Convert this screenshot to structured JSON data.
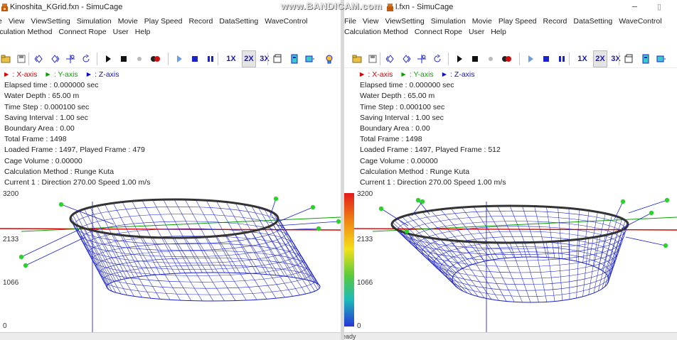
{
  "left": {
    "title": "Kinoshita_KGrid.fxn - SimuCage",
    "menu_row1": [
      "e",
      "View",
      "ViewSetting",
      "Simulation",
      "Movie",
      "Play Speed",
      "Record",
      "DataSetting",
      "WaveControl"
    ],
    "menu_row2": [
      "lculation Method",
      "Connect Rope",
      "User",
      "Help"
    ],
    "toolbar": {
      "speed_1x": "1X",
      "speed_2x": "2X",
      "speed_3x": "3X"
    },
    "axis_legend": {
      "x": ": X-axis",
      "y": ": Y-axis",
      "z": ": Z-axis"
    },
    "info": [
      "Elapsed time : 0.000000 sec",
      "Water Depth : 65.00 m",
      "Time Step : 0.000100 sec",
      "Saving Interval : 1.00 sec",
      "Boundary Area : 0.00",
      "Total Frame : 1498",
      "Loaded Frame : 1497, Played Frame : 479",
      "Cage Volume : 0.00000",
      "Calculation Method : Runge Kuta",
      "Current 1 : Direction 270.00 Speed 1.00 m/s"
    ],
    "depth_ticks": [
      "3200",
      "2133",
      "1066",
      "0"
    ]
  },
  "right": {
    "title": "l.fxn - SimuCage",
    "menu_row1": [
      "File",
      "View",
      "ViewSetting",
      "Simulation",
      "Movie",
      "Play Speed",
      "Record",
      "DataSetting",
      "WaveControl"
    ],
    "menu_row2": [
      "Calculation Method",
      "Connect Rope",
      "User",
      "Help"
    ],
    "toolbar": {
      "speed_1x": "1X",
      "speed_2x": "2X",
      "speed_3x": "3X"
    },
    "axis_legend": {
      "x": ": X-axis",
      "y": ": Y-axis",
      "z": ": Z-axis"
    },
    "info": [
      "Elapsed time : 0.000000 sec",
      "Water Depth : 65.00 m",
      "Time Step : 0.000100 sec",
      "Saving Interval : 1.00 sec",
      "Boundary Area : 0.00",
      "Total Frame : 1498",
      "Loaded Frame : 1497, Played Frame : 512",
      "Cage Volume : 0.00000",
      "Calculation Method : Runge Kuta",
      "Current 1 : Direction 270.00 Speed 1.00 m/s"
    ],
    "depth_ticks": [
      "3200",
      "2133",
      "1066",
      "0"
    ]
  },
  "watermark": "www.BANDICAM.com",
  "status_text": "ready",
  "colors": {
    "x_axis": "#d40000",
    "y_axis": "#0aa000",
    "z_axis": "#1010c0",
    "net": "#1b22c8",
    "rim": "#333333",
    "buoy": "#2dd12d"
  },
  "icons": [
    "open-folder-icon",
    "save-icon",
    "rotate-icon",
    "rotate-alt-icon",
    "move-icon",
    "refresh-icon",
    "play-icon",
    "stop-icon",
    "record-dot-icon",
    "record-red-icon",
    "play-step-icon",
    "stop-blue-icon",
    "pause-blue-icon",
    "window-icon",
    "panel-icon",
    "panel-alt-icon",
    "bulb-icon"
  ]
}
